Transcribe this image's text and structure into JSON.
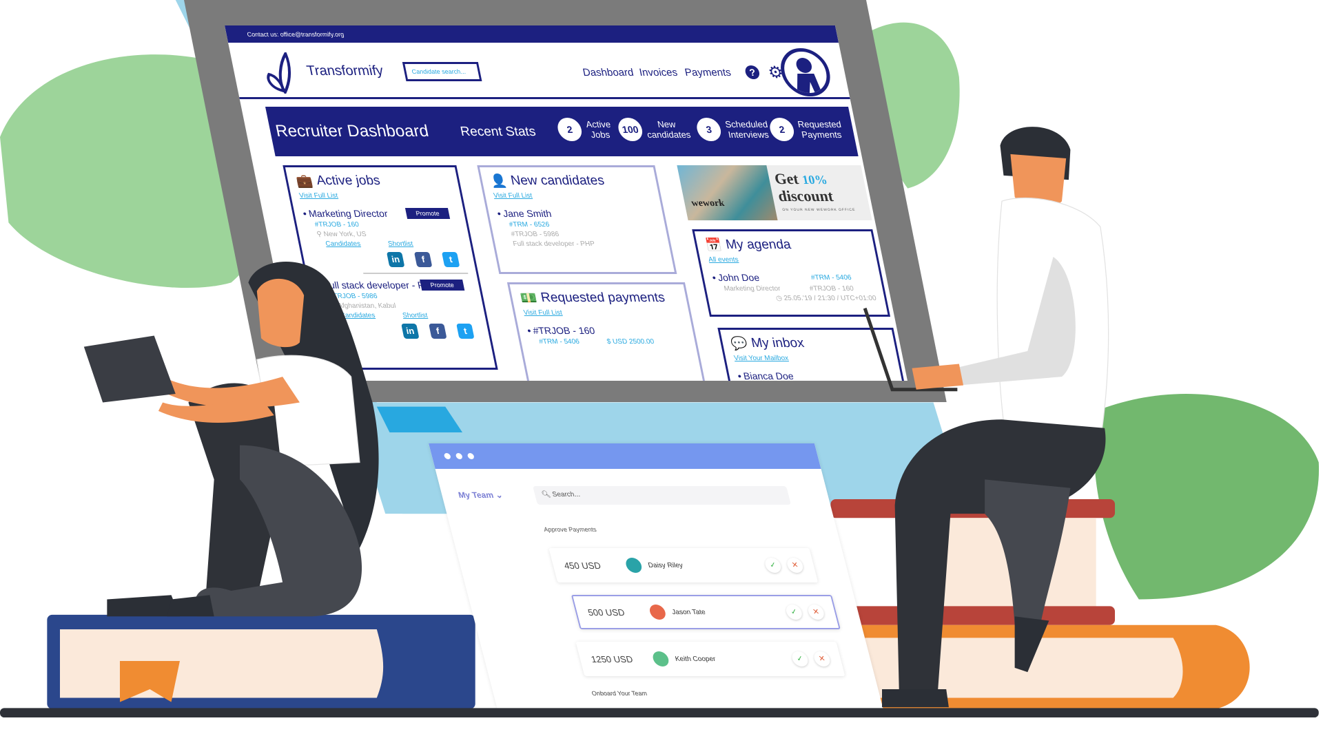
{
  "dashboard": {
    "contact": "Contact us: office@transformify.org",
    "brand": "Transformify",
    "search_placeholder": "Candidate search...",
    "nav": [
      "Dashboard",
      "Invoices",
      "Payments"
    ],
    "help_icon": "question-circle-icon",
    "settings_icon": "gear-icon",
    "banner": {
      "title": "Recruiter Dashboard",
      "stats_label": "Recent Stats",
      "stats": [
        {
          "value": "2",
          "label": "Active Jobs"
        },
        {
          "value": "100",
          "label": "New candidates"
        },
        {
          "value": "3",
          "label": "Scheduled Interviews"
        },
        {
          "value": "2",
          "label": "Requested Payments"
        }
      ]
    },
    "active_jobs": {
      "title": "Active jobs",
      "link": "Visit Full List",
      "jobs": [
        {
          "title": "Marketing Director",
          "code": "#TRJOB - 160",
          "location": "New York, US",
          "candidates": "Candidates",
          "shortlist": "Shortlist",
          "promote": "Promote"
        },
        {
          "title": "Full stack developer - PHP",
          "code": "#TRJOB - 5986",
          "location": "Afghanistan, Kabul",
          "candidates": "Candidates",
          "shortlist": "Shortlist",
          "promote": "Promote"
        }
      ]
    },
    "new_candidates": {
      "title": "New candidates",
      "link": "Visit Full List",
      "name": "Jane Smith",
      "code": "#TRM - 6526",
      "job": "#TRJOB - 5986",
      "role": "Full stack developer - PHP"
    },
    "requested_payments": {
      "title": "Requested payments",
      "link": "Visit Full List",
      "job": "#TRJOB - 160",
      "code": "#TRM - 5406",
      "amount": "USD 2500.00"
    },
    "ad": {
      "brand": "wework",
      "line1": "Get",
      "highlight": "10%",
      "line2": "discount",
      "sub": "ON YOUR NEW WEWORK OFFICE"
    },
    "agenda": {
      "title": "My agenda",
      "link": "All events",
      "name": "John Doe",
      "code": "#TRM - 5406",
      "role": "Marketing Director",
      "job": "#TRJOB - 160",
      "time": "25.05.'19 / 21:30 / UTC+01:00"
    },
    "inbox": {
      "title": "My inbox",
      "link": "Visit Your Mailbox",
      "name": "Bianca Doe"
    }
  },
  "team_window": {
    "menu": "My Team",
    "search_placeholder": "Search...",
    "section": "Approve Payments",
    "payments": [
      {
        "amount": "450 USD",
        "name": "Daisy Riley",
        "avatar_color": "#2aa3a8"
      },
      {
        "amount": "500 USD",
        "name": "Jason Tate",
        "avatar_color": "#e8684a"
      },
      {
        "amount": "1250 USD",
        "name": "Keith Cooper",
        "avatar_color": "#5cc08a"
      }
    ],
    "footer": "Onboard Your Team"
  },
  "colors": {
    "navy": "#1c2080",
    "link": "#29a9e0",
    "window_header": "#7597ef",
    "leaf": "#9dd49a"
  }
}
